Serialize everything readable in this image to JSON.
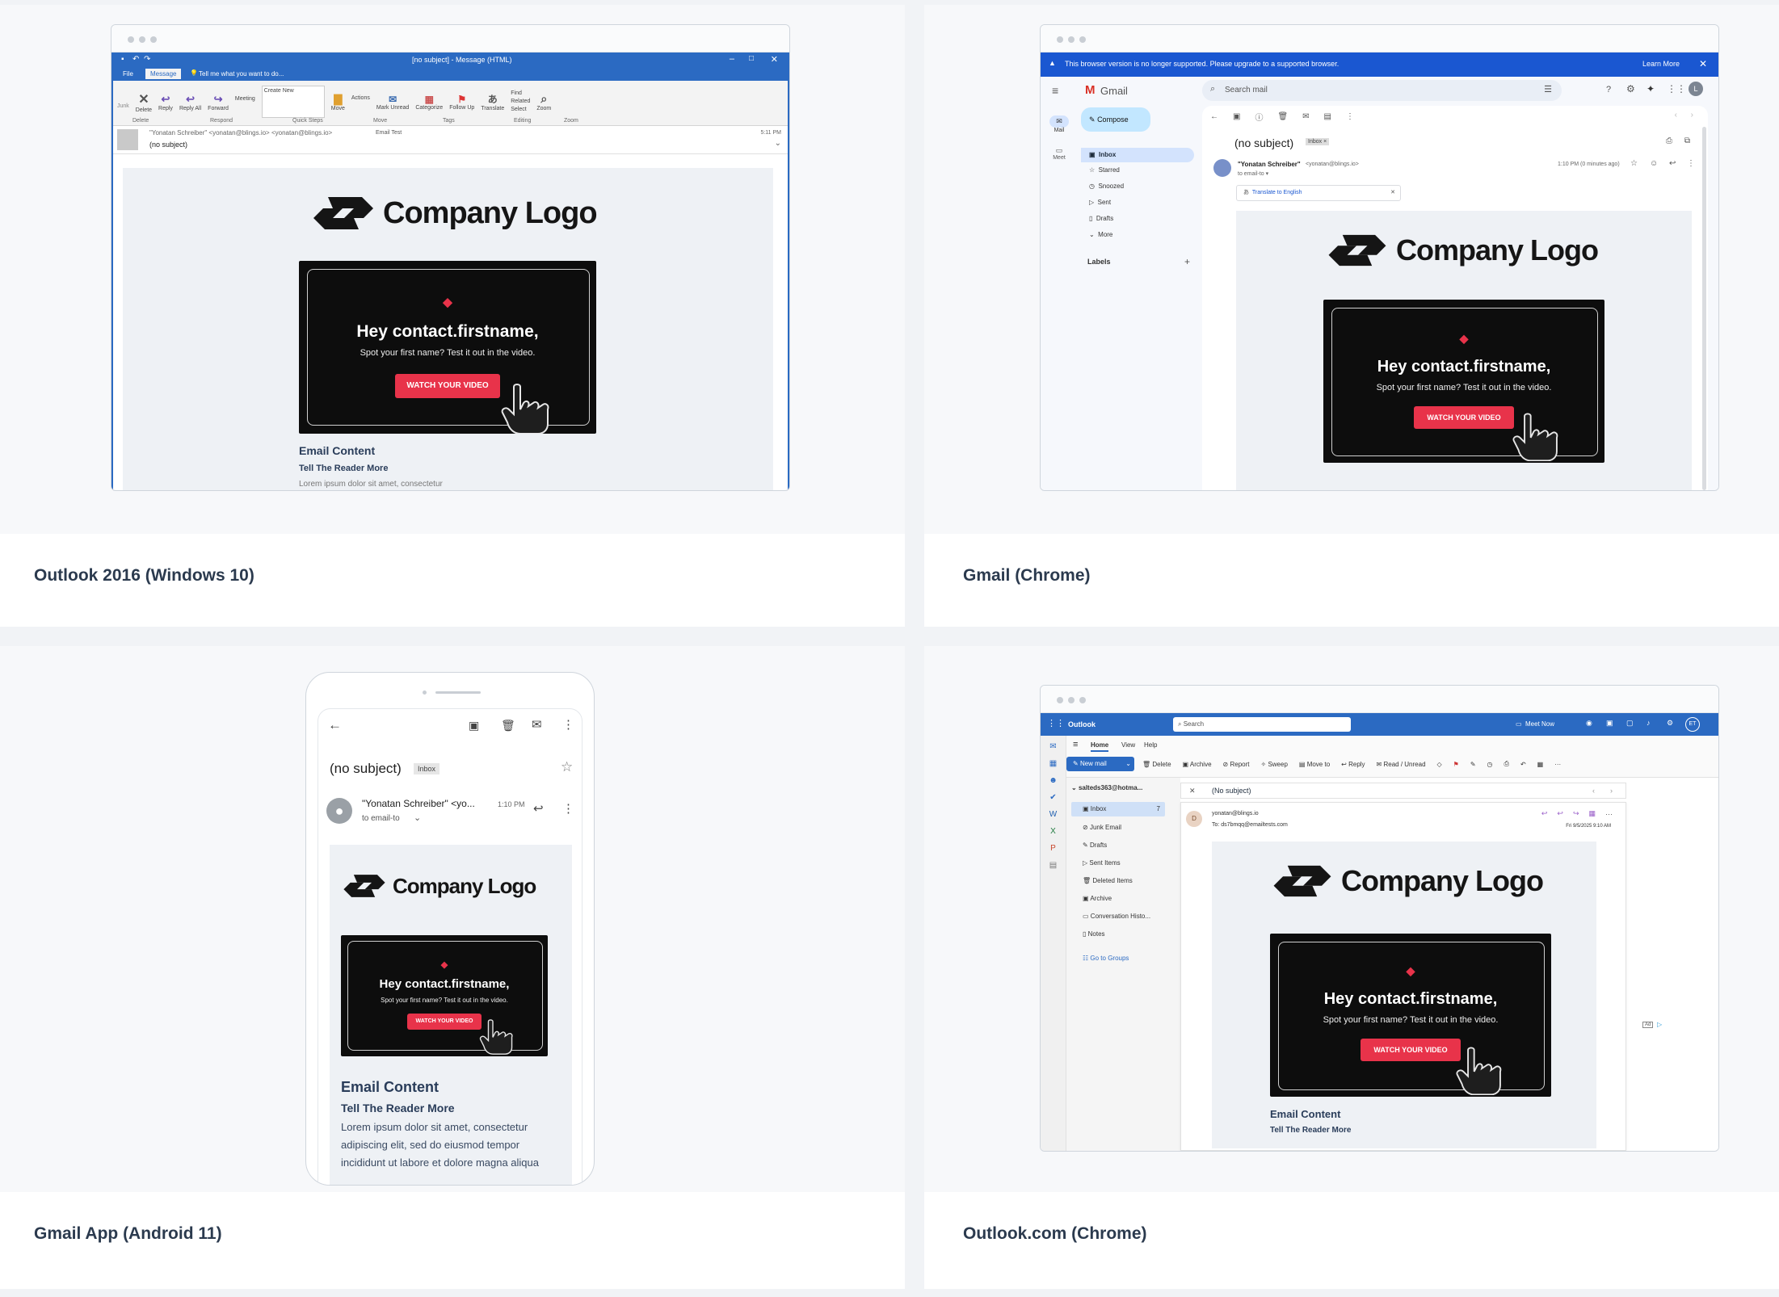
{
  "cards": [
    {
      "caption": "Outlook 2016 (Windows 10)"
    },
    {
      "caption": "Gmail (Chrome)"
    },
    {
      "caption": "Gmail App (Android 11)"
    },
    {
      "caption": "Outlook.com (Chrome)"
    }
  ],
  "email": {
    "logo_text": "Company Logo",
    "video_heading": "Hey contact.firstname,",
    "video_sub": "Spot your first name? Test it out in the video.",
    "video_button": "WATCH YOUR VIDEO",
    "content_title": "Email Content",
    "content_subtitle": "Tell The Reader More",
    "body_text_1": "Lorem ipsum dolor sit amet, consectetur",
    "body_text_2": "adipiscing elit, sed do eiusmod tempor",
    "body_text_3": "incididunt ut labore et dolore magna aliqua"
  },
  "outlook2016": {
    "title": "[no subject] - Message (HTML)",
    "tabs": [
      "File",
      "Message"
    ],
    "tell_me": "Tell me what you want to do...",
    "ribbon": [
      "Junk",
      "Delete",
      "Reply",
      "Reply All",
      "Forward",
      "Meeting",
      "More",
      "Create New",
      "Move",
      "Actions",
      "Mark Unread",
      "Categorize",
      "Follow Up",
      "Translate",
      "Find",
      "Related",
      "Select",
      "Zoom"
    ],
    "groups": [
      "Delete",
      "Respond",
      "Quick Steps",
      "Move",
      "Tags",
      "Editing",
      "Zoom"
    ],
    "sender": "\"Yonatan Schreiber\" <yonatan@blings.io> <yonatan@blings.io>",
    "label": "Email Test",
    "subject": "(no subject)",
    "time": "5:11 PM"
  },
  "gmail": {
    "banner": "This browser version is no longer supported. Please upgrade to a supported browser.",
    "learn_more": "Learn More",
    "brand": "Gmail",
    "search_placeholder": "Search mail",
    "compose": "Compose",
    "rail": [
      "Mail",
      "Meet"
    ],
    "folders": [
      "Inbox",
      "Starred",
      "Snoozed",
      "Sent",
      "Drafts",
      "More"
    ],
    "labels": "Labels",
    "subject": "(no subject)",
    "inbox_chip": "Inbox ×",
    "sender": "\"Yonatan Schreiber\"",
    "sender_email": "<yonatan@blings.io>",
    "to": "to email-to ▾",
    "time": "1:10 PM (0 minutes ago)",
    "translate": "Translate to English"
  },
  "android": {
    "subject": "(no subject)",
    "chip": "Inbox",
    "sender": "\"Yonatan Schreiber\" <yo...",
    "time": "1:10 PM",
    "to": "to email-to"
  },
  "outlookcom": {
    "brand": "Outlook",
    "search": "Search",
    "meet_now": "Meet Now",
    "menu_tabs": [
      "Home",
      "View",
      "Help"
    ],
    "new_mail": "New mail",
    "toolbar": [
      "Delete",
      "Archive",
      "Report",
      "Sweep",
      "Move to",
      "Reply",
      "Read / Unread"
    ],
    "account": "salteds363@hotma...",
    "folders": [
      "Inbox",
      "Junk Email",
      "Drafts",
      "Sent Items",
      "Deleted Items",
      "Archive",
      "Conversation Histo...",
      "Notes"
    ],
    "inbox_count": "7",
    "groups_link": "Go to Groups",
    "subject": "(No subject)",
    "from": "yonatan@blings.io",
    "to": "To: ds7bmqq@emailtests.com",
    "date": "Fri 9/5/2025 9:10 AM",
    "avatar": "D",
    "ad": "Ad"
  },
  "colors": {
    "outlook_blue": "#2b6ac2",
    "gmail_banner": "#1a57d1",
    "cta_red": "#e8334a",
    "email_bg": "#eef1f5",
    "caption_text": "#2b3a4e"
  }
}
